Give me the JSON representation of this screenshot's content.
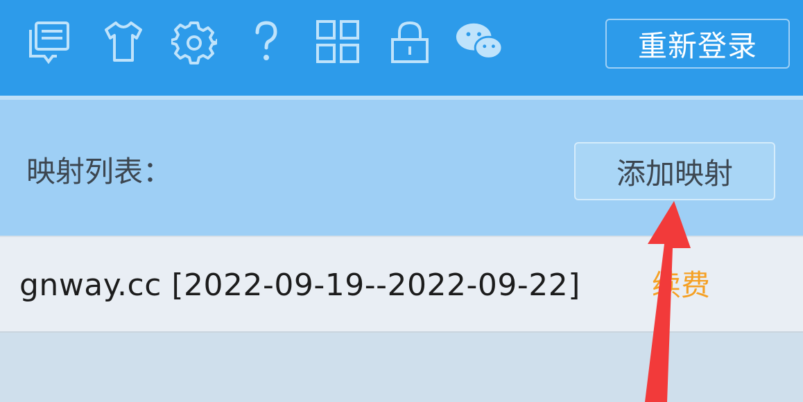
{
  "toolbar": {
    "icons": [
      {
        "name": "message-icon"
      },
      {
        "name": "tshirt-icon"
      },
      {
        "name": "gear-icon"
      },
      {
        "name": "help-icon"
      },
      {
        "name": "grid-icon"
      },
      {
        "name": "lock-icon"
      },
      {
        "name": "wechat-icon"
      }
    ],
    "relogin_label": "重新登录"
  },
  "mapping": {
    "title": "映射列表：",
    "add_label": "添加映射",
    "rows": [
      {
        "domain": "gnway.cc [2022-09-19--2022-09-22]",
        "action": "续费"
      }
    ]
  },
  "colors": {
    "toolbar_bg": "#2d9bea",
    "header_bg": "#9ecff5",
    "row_bg": "#e9eef4",
    "renew_color": "#f5a023",
    "arrow_color": "#f23a3a"
  }
}
